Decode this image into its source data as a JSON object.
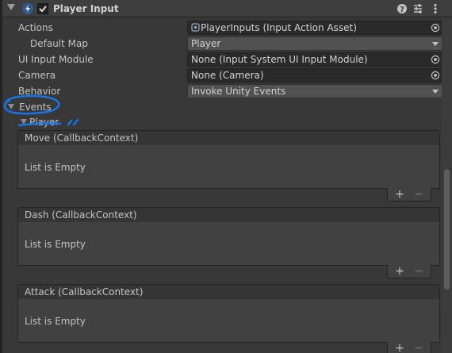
{
  "component": {
    "title": "Player Input",
    "enabled": true,
    "icons": [
      "foldout-expanded-icon",
      "script-icon",
      "help-icon",
      "preset-icon",
      "context-menu-icon"
    ]
  },
  "properties": {
    "actions": {
      "label": "Actions",
      "value": "PlayerInputs (Input Action Asset)"
    },
    "default_map": {
      "label": "Default Map",
      "value": "Player"
    },
    "ui_input_module": {
      "label": "UI Input Module",
      "value": "None (Input System UI Input Module)"
    },
    "camera": {
      "label": "Camera",
      "value": "None (Camera)"
    },
    "behavior": {
      "label": "Behavior",
      "value": "Invoke Unity Events"
    }
  },
  "events_foldout": {
    "label": "Events",
    "expanded": true
  },
  "player_foldout": {
    "label": "Player",
    "expanded": true
  },
  "events": [
    {
      "label": "Move (CallbackContext)",
      "empty_text": "List is Empty",
      "add": "+",
      "remove": "−"
    },
    {
      "label": "Dash (CallbackContext)",
      "empty_text": "List is Empty",
      "add": "+",
      "remove": "−"
    },
    {
      "label": "Attack (CallbackContext)",
      "empty_text": "List is Empty",
      "add": "+",
      "remove": "−"
    }
  ],
  "annotation": {
    "color": "#1a73e8"
  },
  "colors": {
    "background": "#383838",
    "field_background": "#2a2a2a",
    "dropdown_background": "#515151",
    "text": "#c4c4c4"
  }
}
